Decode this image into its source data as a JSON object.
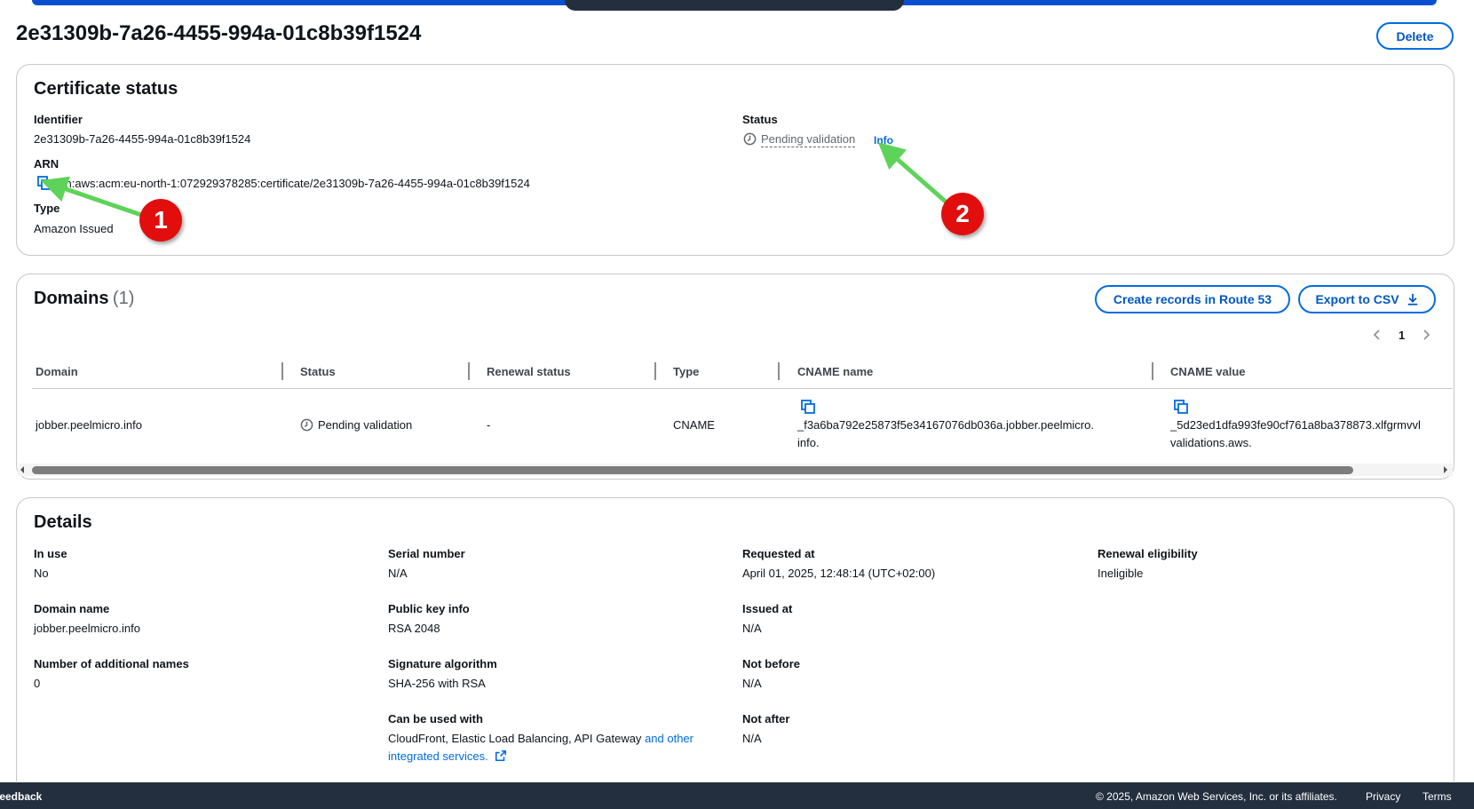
{
  "page": {
    "title": "2e31309b-7a26-4455-994a-01c8b39f1524",
    "delete_label": "Delete"
  },
  "cert_status": {
    "heading": "Certificate status",
    "identifier_label": "Identifier",
    "identifier_value": "2e31309b-7a26-4455-994a-01c8b39f1524",
    "arn_label": "ARN",
    "arn_value": "arn:aws:acm:eu-north-1:072929378285:certificate/2e31309b-7a26-4455-994a-01c8b39f1524",
    "type_label": "Type",
    "type_value": "Amazon Issued",
    "status_label": "Status",
    "status_value": "Pending validation",
    "info_label": "Info"
  },
  "domains": {
    "heading": "Domains",
    "count": "(1)",
    "create_records_label": "Create records in Route 53",
    "export_label": "Export to CSV",
    "page_number": "1",
    "columns": [
      "Domain",
      "Status",
      "Renewal status",
      "Type",
      "CNAME name",
      "CNAME value"
    ],
    "rows": [
      {
        "domain": "jobber.peelmicro.info",
        "status": "Pending validation",
        "renewal_status": "-",
        "type": "CNAME",
        "cname_name_line1": "_f3a6ba792e25873f5e34167076db036a.jobber.peelmicro.",
        "cname_name_line2": "info.",
        "cname_value_line1": "_5d23ed1dfa993fe90cf761a8ba378873.xlfgrmvvl",
        "cname_value_line2": "validations.aws."
      }
    ]
  },
  "details": {
    "heading": "Details",
    "in_use_label": "In use",
    "in_use_value": "No",
    "domain_name_label": "Domain name",
    "domain_name_value": "jobber.peelmicro.info",
    "additional_names_label": "Number of additional names",
    "additional_names_value": "0",
    "serial_label": "Serial number",
    "serial_value": "N/A",
    "public_key_label": "Public key info",
    "public_key_value": "RSA 2048",
    "sig_label": "Signature algorithm",
    "sig_value": "SHA-256 with RSA",
    "used_with_label": "Can be used with",
    "used_with_value": "CloudFront, Elastic Load Balancing, API Gateway",
    "used_with_link_1": "and other",
    "used_with_link_2": "integrated services.",
    "requested_label": "Requested at",
    "requested_value": "April 01, 2025, 12:48:14 (UTC+02:00)",
    "issued_label": "Issued at",
    "issued_value": "N/A",
    "not_before_label": "Not before",
    "not_before_value": "N/A",
    "not_after_label": "Not after",
    "not_after_value": "N/A",
    "renewal_label": "Renewal eligibility",
    "renewal_value": "Ineligible"
  },
  "annotations": {
    "badge_1": "1",
    "badge_2": "2"
  },
  "footer": {
    "feedback": "Feedback",
    "copyright": "© 2025, Amazon Web Services, Inc. or its affiliates.",
    "privacy": "Privacy",
    "terms": "Terms"
  },
  "colors": {
    "accent": "#006ce0",
    "annotation_badge": "#e20e0e",
    "annotation_arrow": "#5ed35a",
    "footer_bg": "#232f3e"
  },
  "icons": [
    "copy-icon",
    "clock-icon",
    "download-icon",
    "external-link-icon",
    "chevron-left-icon",
    "chevron-right-icon"
  ]
}
